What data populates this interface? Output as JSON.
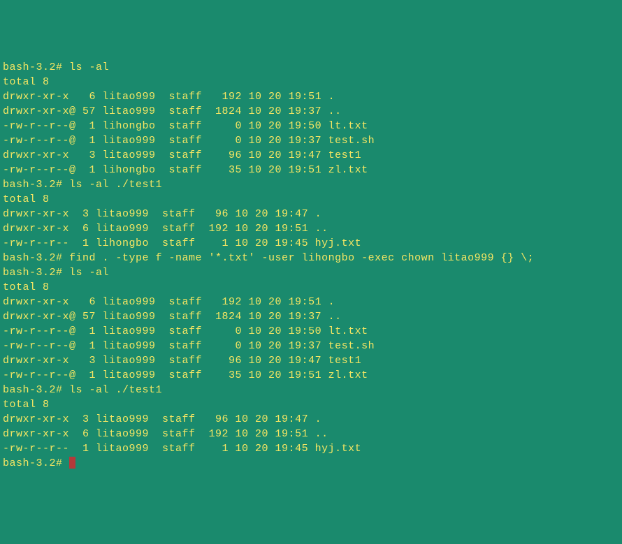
{
  "lines": [
    "bash-3.2# ls -al",
    "total 8",
    "drwxr-xr-x   6 litao999  staff   192 10 20 19:51 .",
    "drwxr-xr-x@ 57 litao999  staff  1824 10 20 19:37 ..",
    "-rw-r--r--@  1 lihongbo  staff     0 10 20 19:50 lt.txt",
    "-rw-r--r--@  1 litao999  staff     0 10 20 19:37 test.sh",
    "drwxr-xr-x   3 litao999  staff    96 10 20 19:47 test1",
    "-rw-r--r--@  1 lihongbo  staff    35 10 20 19:51 zl.txt",
    "bash-3.2# ls -al ./test1",
    "total 8",
    "drwxr-xr-x  3 litao999  staff   96 10 20 19:47 .",
    "drwxr-xr-x  6 litao999  staff  192 10 20 19:51 ..",
    "-rw-r--r--  1 lihongbo  staff    1 10 20 19:45 hyj.txt",
    "bash-3.2# find . -type f -name '*.txt' -user lihongbo -exec chown litao999 {} \\;",
    "",
    "bash-3.2# ls -al",
    "total 8",
    "drwxr-xr-x   6 litao999  staff   192 10 20 19:51 .",
    "drwxr-xr-x@ 57 litao999  staff  1824 10 20 19:37 ..",
    "-rw-r--r--@  1 litao999  staff     0 10 20 19:50 lt.txt",
    "-rw-r--r--@  1 litao999  staff     0 10 20 19:37 test.sh",
    "drwxr-xr-x   3 litao999  staff    96 10 20 19:47 test1",
    "-rw-r--r--@  1 litao999  staff    35 10 20 19:51 zl.txt",
    "bash-3.2# ls -al ./test1",
    "total 8",
    "drwxr-xr-x  3 litao999  staff   96 10 20 19:47 .",
    "drwxr-xr-x  6 litao999  staff  192 10 20 19:51 ..",
    "-rw-r--r--  1 litao999  staff    1 10 20 19:45 hyj.txt"
  ],
  "final_prompt": "bash-3.2# "
}
